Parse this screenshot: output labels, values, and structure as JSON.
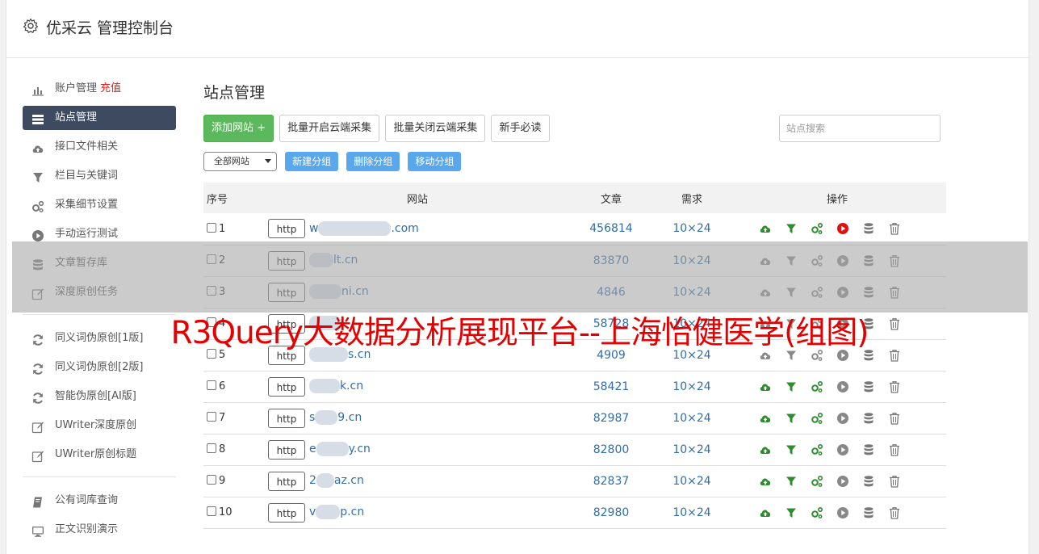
{
  "app": {
    "title": "优采云 管理控制台"
  },
  "sidebar": {
    "items": [
      {
        "label": "账户管理",
        "extra": "充值",
        "icon": "bar-chart-icon",
        "active": false
      },
      {
        "label": "站点管理",
        "icon": "server-list-icon",
        "active": true
      },
      {
        "label": "接口文件相关",
        "icon": "cloud-upload-icon",
        "active": false
      },
      {
        "label": "栏目与关键词",
        "icon": "filter-icon",
        "active": false
      },
      {
        "label": "采集细节设置",
        "icon": "gears-icon",
        "active": false
      },
      {
        "label": "手动运行测试",
        "icon": "play-circle-icon",
        "active": false
      },
      {
        "label": "文章暂存库",
        "icon": "database-icon",
        "active": false
      },
      {
        "label": "深度原创任务",
        "icon": "edit-icon",
        "active": false
      }
    ],
    "group2": [
      {
        "label": "同义词伪原创[1版]",
        "icon": "refresh-icon"
      },
      {
        "label": "同义词伪原创[2版]",
        "icon": "refresh-icon"
      },
      {
        "label": "智能伪原创[AI版]",
        "icon": "refresh-icon"
      },
      {
        "label": "UWriter深度原创",
        "icon": "edit-icon"
      },
      {
        "label": "UWriter原创标题",
        "icon": "edit-icon"
      }
    ],
    "group3": [
      {
        "label": "公有词库查询",
        "icon": "book-icon"
      },
      {
        "label": "正文识别演示",
        "icon": "monitor-icon"
      }
    ]
  },
  "main": {
    "title": "站点管理",
    "toolbar": {
      "add": "添加网站 +",
      "enable_all": "批量开启云端采集",
      "disable_all": "批量关闭云端采集",
      "guide": "新手必读",
      "search_placeholder": "站点搜索"
    },
    "groupbar": {
      "select_value": "全部网站",
      "new_group": "新建分组",
      "delete_group": "删除分组",
      "move_group": "移动分组"
    },
    "table": {
      "headers": [
        "序号",
        "网站",
        "文章",
        "需求",
        "操作"
      ],
      "rows": [
        {
          "no": "1",
          "proto": "http",
          "domain_prefix": "w",
          "domain": ".com",
          "articles": "456814",
          "demand": "10×24",
          "running": true,
          "active": true
        },
        {
          "no": "2",
          "proto": "http",
          "domain_prefix": "",
          "domain": "lt.cn",
          "articles": "83870",
          "demand": "10×24",
          "running": false,
          "active": false
        },
        {
          "no": "3",
          "proto": "http",
          "domain_prefix": "",
          "domain": "ni.cn",
          "articles": "4846",
          "demand": "10×24",
          "running": false,
          "active": false
        },
        {
          "no": "4",
          "proto": "http",
          "domain_prefix": "",
          "domain": "",
          "articles": "58728",
          "demand": "10×24",
          "running": false,
          "active": false
        },
        {
          "no": "5",
          "proto": "http",
          "domain_prefix": "",
          "domain": "s.cn",
          "articles": "4909",
          "demand": "10×24",
          "running": false,
          "active": false
        },
        {
          "no": "6",
          "proto": "http",
          "domain_prefix": "",
          "domain": "k.cn",
          "articles": "58421",
          "demand": "10×24",
          "running": false,
          "active": true
        },
        {
          "no": "7",
          "proto": "http",
          "domain_prefix": "s",
          "domain": "9.cn",
          "articles": "82987",
          "demand": "10×24",
          "running": false,
          "active": true
        },
        {
          "no": "8",
          "proto": "http",
          "domain_prefix": "e",
          "domain": "y.cn",
          "articles": "82800",
          "demand": "10×24",
          "running": false,
          "active": true
        },
        {
          "no": "9",
          "proto": "http",
          "domain_prefix": "2",
          "domain": "az.cn",
          "articles": "82837",
          "demand": "10×24",
          "running": false,
          "active": true
        },
        {
          "no": "10",
          "proto": "http",
          "domain_prefix": "v",
          "domain": "p.cn",
          "articles": "82980",
          "demand": "10×24",
          "running": false,
          "active": true
        }
      ]
    }
  },
  "watermark": "R3Query大数据分析展现平台--上海怡健医学(组图)",
  "colors": {
    "sidebar_active": "#3e4a60",
    "green": "#5cb85c",
    "link": "#2f6ea8",
    "red": "#e40000",
    "blue_btn": "#59a7ec"
  }
}
